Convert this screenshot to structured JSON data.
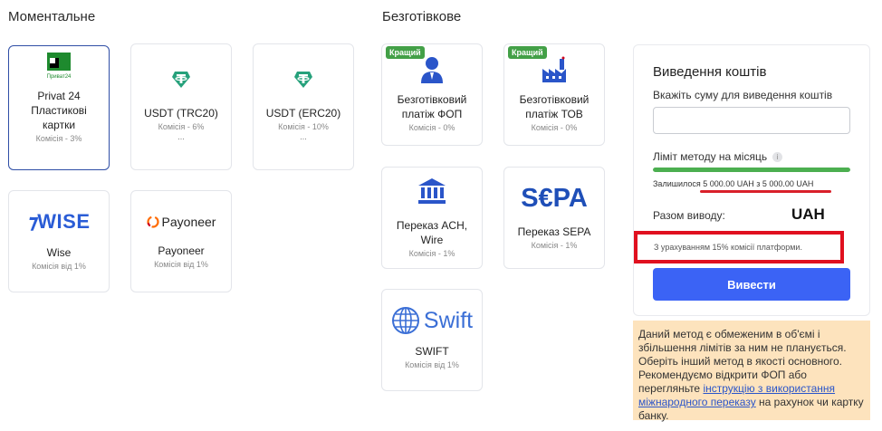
{
  "sections": {
    "instant_title": "Моментальне",
    "cashless_title": "Безготівкове"
  },
  "instant_methods": [
    {
      "name_lines": [
        "Privat 24",
        "Пластикові",
        "картки"
      ],
      "fee": "Комісія - 3%",
      "logo_text": "Приват24",
      "icon": "privat24-icon",
      "selected": true
    },
    {
      "name": "USDT (TRC20)",
      "fee": "Комісія - 6%",
      "extra": "...",
      "icon": "tether-icon"
    },
    {
      "name": "USDT (ERC20)",
      "fee": "Комісія - 10%",
      "extra": "...",
      "icon": "tether-icon"
    },
    {
      "name": "Wise",
      "fee": "Комісія від 1%",
      "logo_text": "WISE",
      "icon": "wise-icon"
    },
    {
      "name": "Payoneer",
      "fee": "Комісія від 1%",
      "logo_text": "Payoneer",
      "icon": "payoneer-icon"
    }
  ],
  "cashless_methods": [
    {
      "name_lines": [
        "Безготівковий",
        "платіж ФОП"
      ],
      "fee": "Комісія - 0%",
      "badge": "Кращий",
      "icon": "person-icon"
    },
    {
      "name_lines": [
        "Безготівковий",
        "платіж ТОВ"
      ],
      "fee": "Комісія - 0%",
      "badge": "Кращий",
      "icon": "factory-icon"
    },
    {
      "name_lines": [
        "Переказ ACH,",
        "Wire"
      ],
      "fee": "Комісія - 1%",
      "icon": "bank-icon"
    },
    {
      "name": "Переказ SEPA",
      "fee": "Комісія - 1%",
      "logo_text": "S€PA",
      "icon": "sepa-icon"
    },
    {
      "name": "SWIFT",
      "fee": "Комісія від 1%",
      "logo_text": "Swift",
      "icon": "swift-icon"
    }
  ],
  "withdraw_panel": {
    "title": "Виведення коштів",
    "amount_label": "Вкажіть суму для виведення коштів",
    "amount_value": "",
    "limit_label": "Ліміт методу на місяць",
    "limit_info_glyph": "i",
    "limit_remaining_fraction": 1.0,
    "remaining_text": "Залишилося 5 000.00 UAH з 5 000.00 UAH",
    "total_label": "Разом виводу:",
    "total_currency": "UAH",
    "commission_note": "З урахуванням 15% комісії платформи.",
    "button_label": "Вивести"
  },
  "notice": {
    "text_before": "Даний метод є обмеженим в об'ємі і збільшення лімітів за ним не планується. Оберіть інший метод в якості основного. Рекомендуємо відкрити ФОП або перегляньте ",
    "link_text": "інструкцію з використання міжнародного переказу",
    "text_after": " на рахунок чи картку банку."
  },
  "colors": {
    "accent_blue": "#3b63f5",
    "green": "#43a047",
    "tether": "#26a17b",
    "highlight_red": "#e0101f",
    "notice_bg": "#fde3bd"
  }
}
